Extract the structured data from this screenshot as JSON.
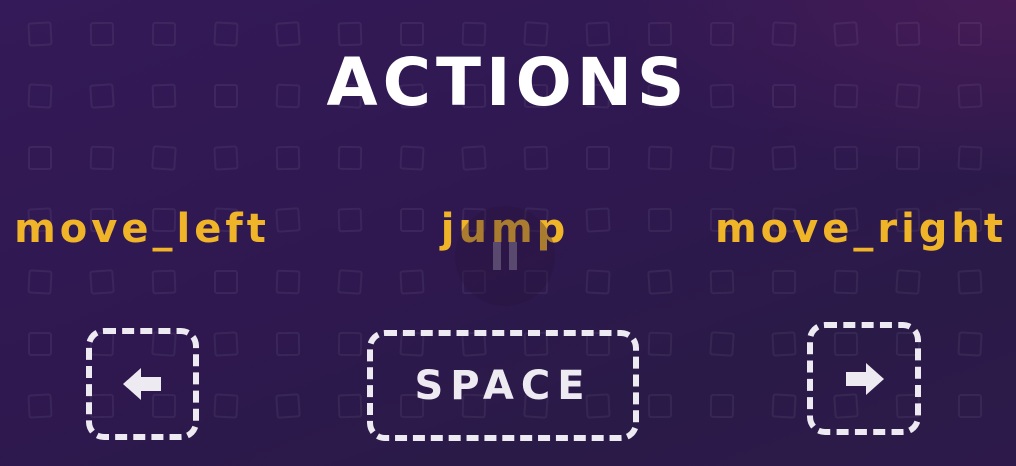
{
  "slide": {
    "title": "ACTIONS"
  },
  "actions": [
    {
      "name": "move_left",
      "key_icon": "arrow-left-icon"
    },
    {
      "name": "jump",
      "key_label": "SPACE"
    },
    {
      "name": "move_right",
      "key_icon": "arrow-right-icon"
    }
  ],
  "player": {
    "state_icon": "pause-icon"
  },
  "colors": {
    "accent": "#f0b429",
    "background": "#2f1850",
    "key": "#eeeaf2"
  }
}
